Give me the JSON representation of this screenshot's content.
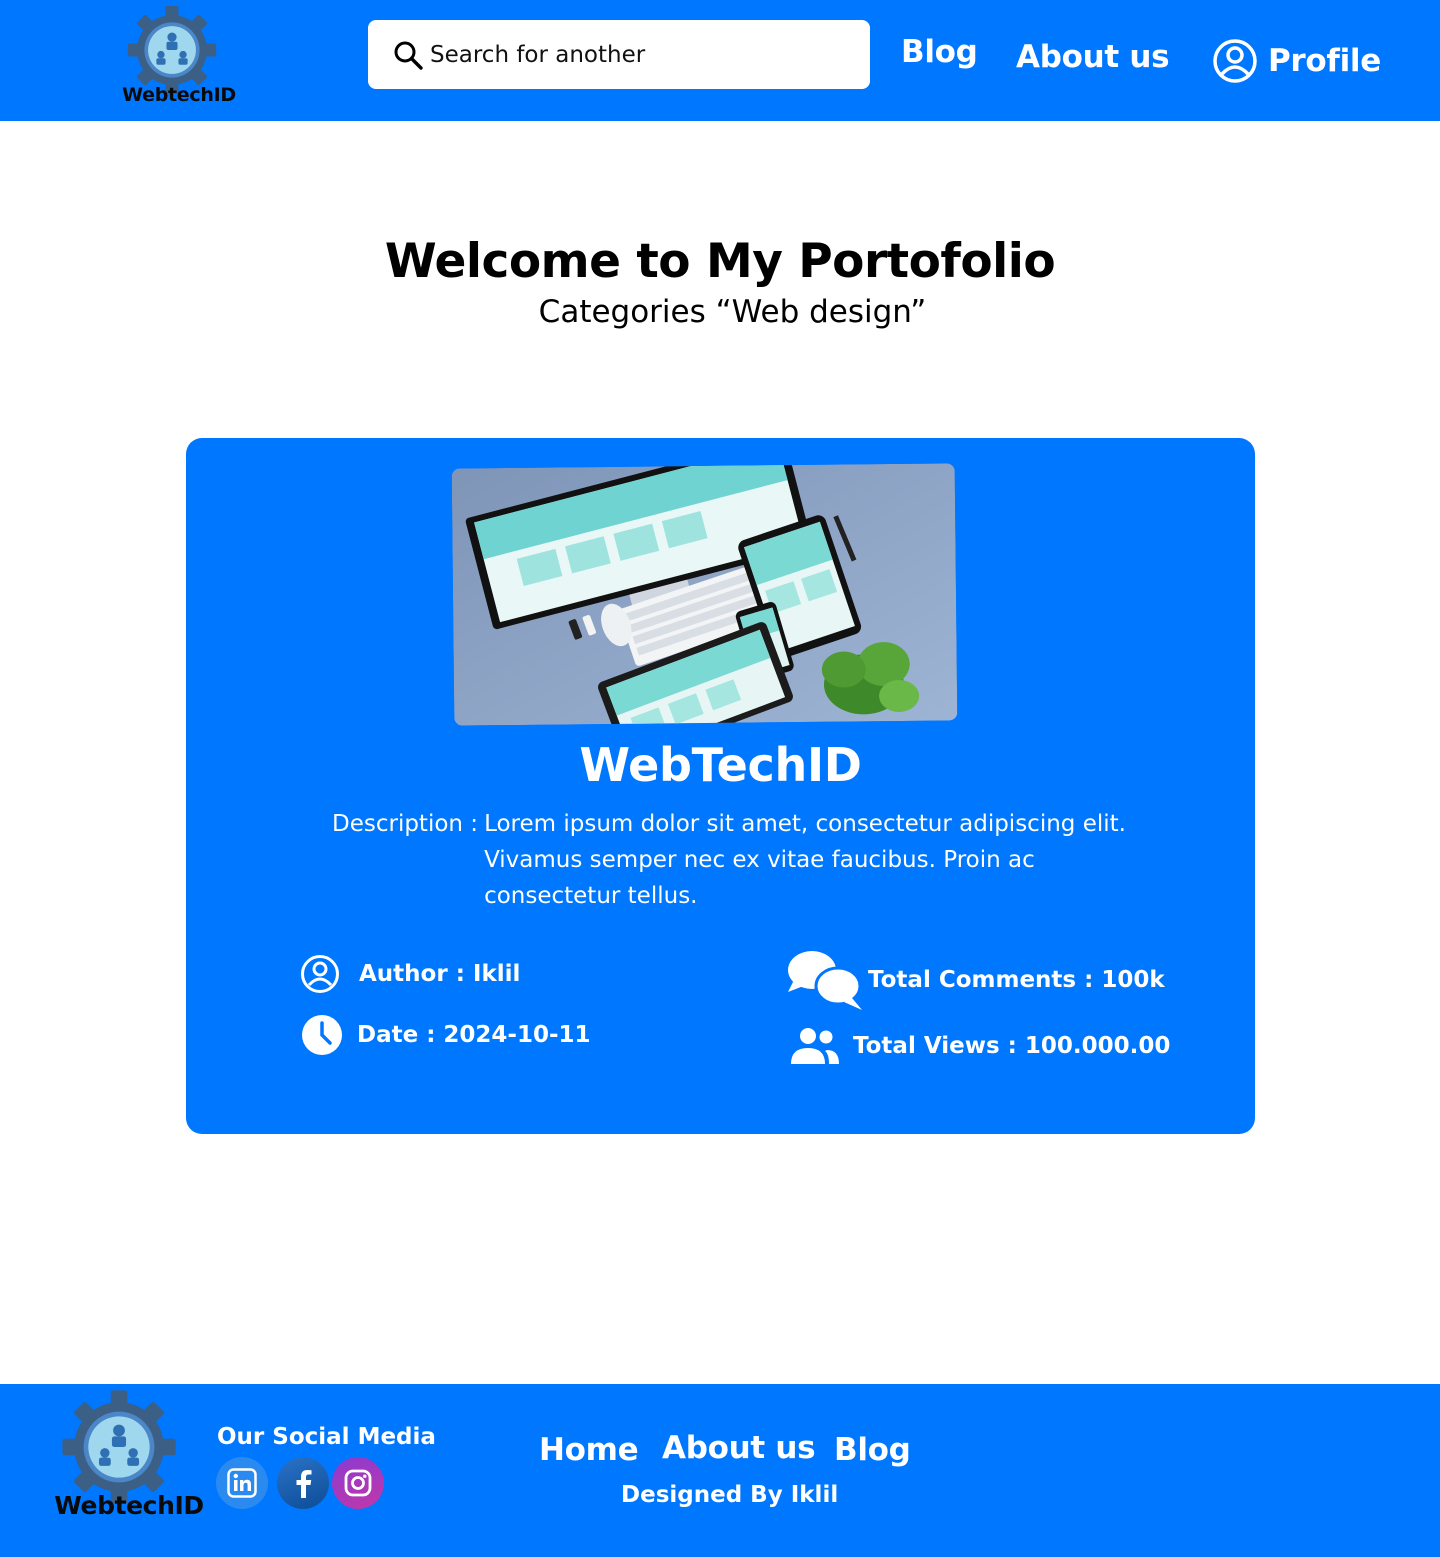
{
  "brand": {
    "name": "WebtechID"
  },
  "header": {
    "search": {
      "placeholder": "Search for another"
    },
    "nav": {
      "blog": "Blog",
      "about": "About us",
      "profile": "Profile"
    }
  },
  "hero": {
    "title": "Welcome to My Portofolio",
    "subtitle": "Categories “Web design”"
  },
  "card": {
    "title": "WebTechID",
    "description_label": "Description :",
    "description": "Lorem ipsum dolor sit amet, consectetur adipiscing elit. Vivamus semper nec ex vitae faucibus. Proin ac consectetur tellus.",
    "author": "Author : Iklil",
    "date": "Date : 2024-10-11",
    "comments": "Total Comments : 100k",
    "views": "Total Views : 100.000.00"
  },
  "footer": {
    "social_title": "Our Social Media",
    "social": [
      "linkedin-icon",
      "facebook-icon",
      "instagram-icon"
    ],
    "nav": {
      "home": "Home",
      "about": "About us",
      "blog": "Blog"
    },
    "credit": "Designed By Iklil"
  },
  "colors": {
    "primary": "#0077ff",
    "background": "#ffffff",
    "text": "#000000"
  }
}
